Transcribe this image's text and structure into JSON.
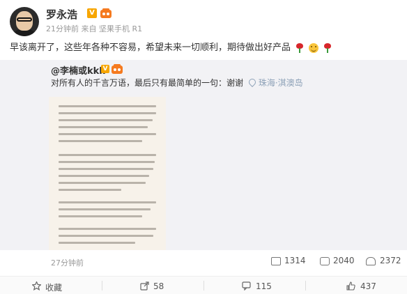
{
  "post": {
    "username": "罗永浩",
    "meta": "21分钟前  来自 坚果手机 R1",
    "text": "早该离开了，这些年各种不容易，希望未来一切顺利，期待做出好产品"
  },
  "repost": {
    "username": "@李楠或kkk",
    "text": "对所有人的千言万语，最后只有最简单的一句：谢谢",
    "location": "珠海·淇澳岛",
    "time": "27分钟前",
    "stats": {
      "reposts": "1314",
      "comments": "2040",
      "likes": "2372"
    }
  },
  "footer": {
    "favorite_label": "收藏",
    "repost_count": "58",
    "comment_count": "115",
    "like_count": "437"
  },
  "icons": [
    "avatar",
    "v-icon",
    "member-icon",
    "rose-icon",
    "smiley-icon",
    "location-pin-icon",
    "share-icon",
    "comment-icon",
    "like-icon",
    "star-icon"
  ],
  "colors": {
    "verified": "#f7a600",
    "location_link": "#8ea2b8",
    "repost_bg": "#f2f2f5"
  }
}
